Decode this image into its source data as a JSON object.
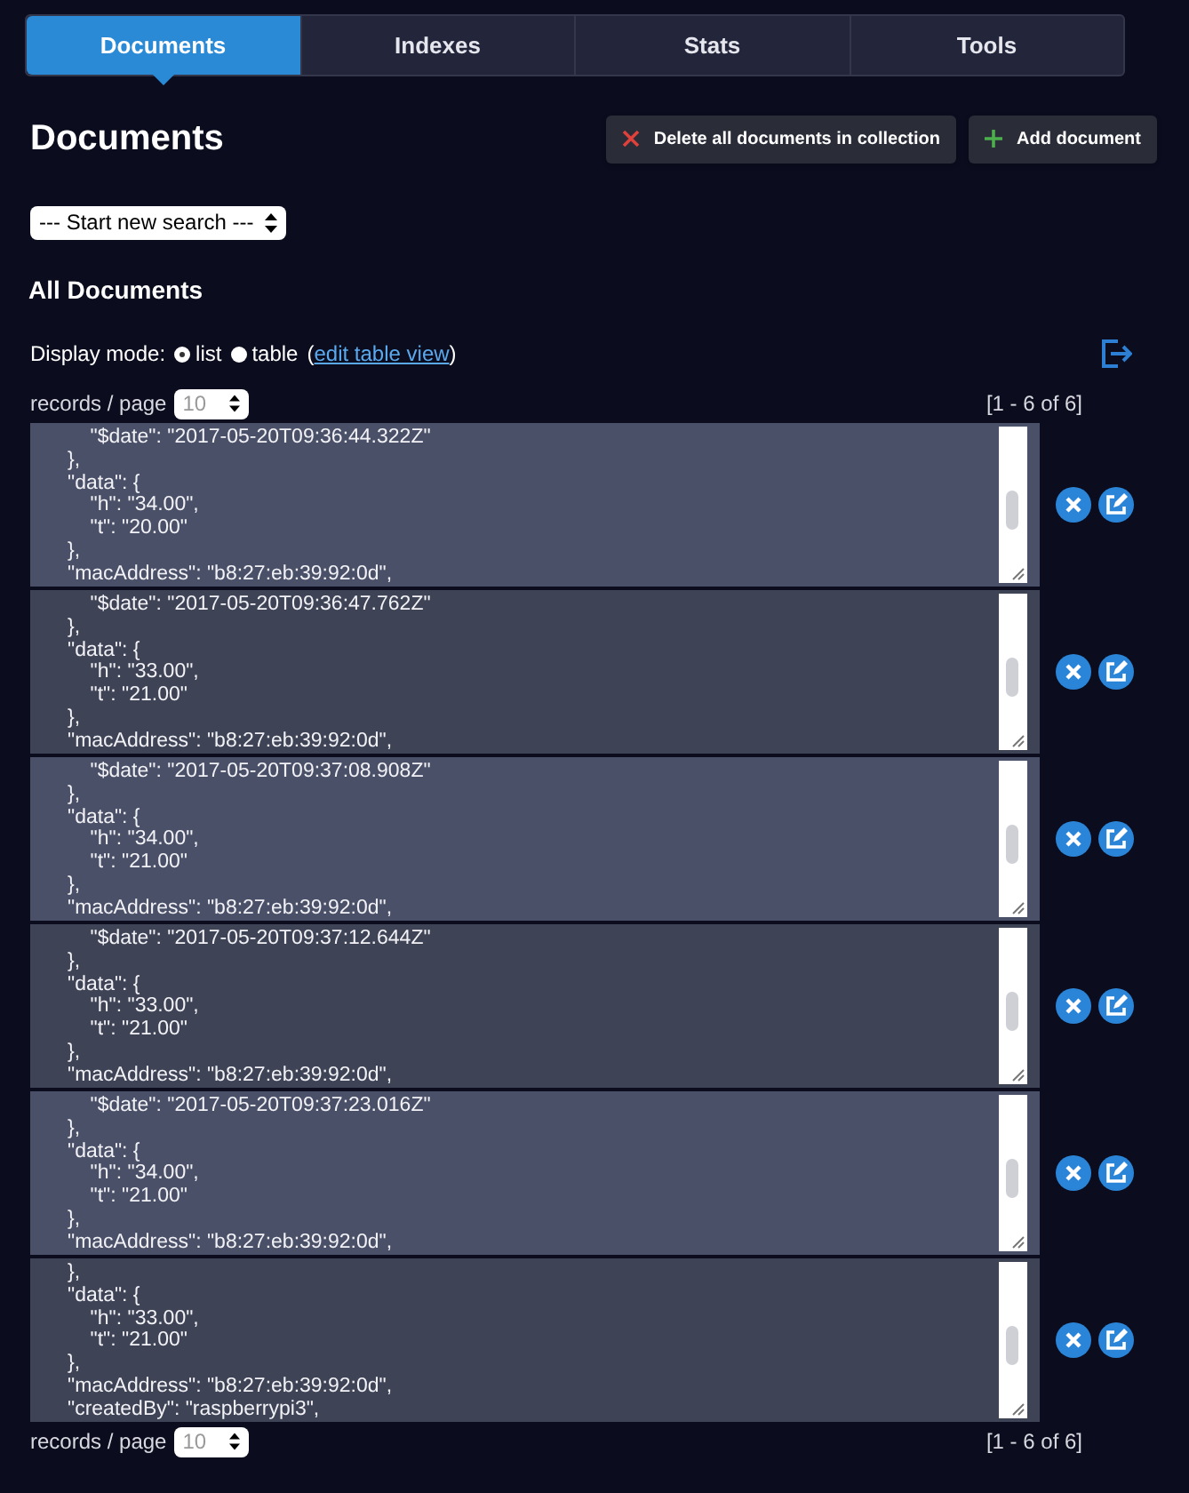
{
  "tabs": [
    {
      "label": "Documents",
      "selected": true
    },
    {
      "label": "Indexes",
      "selected": false
    },
    {
      "label": "Stats",
      "selected": false
    },
    {
      "label": "Tools",
      "selected": false
    }
  ],
  "title": "Documents",
  "actions": [
    {
      "kind": "delete",
      "label": "Delete all documents in collection"
    },
    {
      "kind": "add",
      "label": "Add document"
    }
  ],
  "search_select": {
    "value": "--- Start new search ---"
  },
  "section_title": "All Documents",
  "display_mode": {
    "label": "Display mode:",
    "options": [
      {
        "label": "list",
        "selected": true
      },
      {
        "label": "table",
        "selected": false
      }
    ],
    "open_paren": "(",
    "link": "edit table view",
    "close_paren": ")"
  },
  "pager_top": {
    "label": "records / page",
    "value": "10",
    "range": "[1 - 6 of 6]"
  },
  "records": [
    {
      "text": "    \"$date\": \"2017-05-20T09:36:44.322Z\"\n},\n\"data\": {\n    \"h\": \"34.00\",\n    \"t\": \"20.00\"\n},\n\"macAddress\": \"b8:27:eb:39:92:0d\","
    },
    {
      "text": "    \"$date\": \"2017-05-20T09:36:47.762Z\"\n},\n\"data\": {\n    \"h\": \"33.00\",\n    \"t\": \"21.00\"\n},\n\"macAddress\": \"b8:27:eb:39:92:0d\","
    },
    {
      "text": "    \"$date\": \"2017-05-20T09:37:08.908Z\"\n},\n\"data\": {\n    \"h\": \"34.00\",\n    \"t\": \"21.00\"\n},\n\"macAddress\": \"b8:27:eb:39:92:0d\","
    },
    {
      "text": "    \"$date\": \"2017-05-20T09:37:12.644Z\"\n},\n\"data\": {\n    \"h\": \"33.00\",\n    \"t\": \"21.00\"\n},\n\"macAddress\": \"b8:27:eb:39:92:0d\","
    },
    {
      "text": "    \"$date\": \"2017-05-20T09:37:23.016Z\"\n},\n\"data\": {\n    \"h\": \"34.00\",\n    \"t\": \"21.00\"\n},\n\"macAddress\": \"b8:27:eb:39:92:0d\","
    },
    {
      "text": "},\n\"data\": {\n    \"h\": \"33.00\",\n    \"t\": \"21.00\"\n},\n\"macAddress\": \"b8:27:eb:39:92:0d\",\n\"createdBy\": \"raspberrypi3\","
    }
  ],
  "pager_bottom": {
    "label": "records / page",
    "value": "10",
    "range": "[1 - 6 of 6]"
  }
}
